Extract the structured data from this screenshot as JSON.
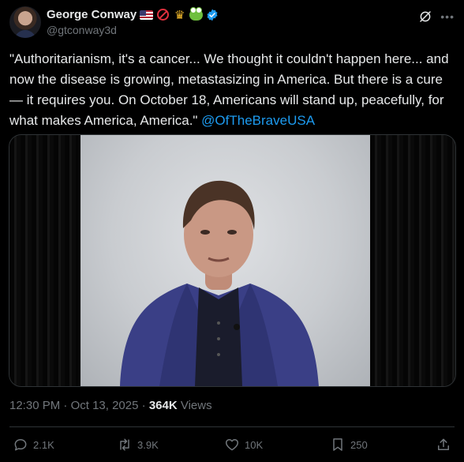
{
  "author": {
    "name": "George Conway",
    "handle": "@gtconway3d",
    "badges": [
      "us-flag-emoji",
      "no-entry-emoji",
      "crown-emoji",
      "frog-emoji",
      "verified-badge"
    ]
  },
  "tweet": {
    "text": "\"Authoritarianism, it's a cancer...  We thought it couldn't happen here... and now the disease is growing, metastasizing in America.  But there is a cure — it requires you.  On October 18, Americans will stand up, peacefully, for what makes America, America.\" ",
    "mention": "@OfTheBraveUSA"
  },
  "meta": {
    "time": "12:30 PM",
    "sep1": " · ",
    "date": "Oct 13, 2025",
    "sep2": " · ",
    "views_count": "364K",
    "views_label": " Views"
  },
  "actions": {
    "replies": "2.1K",
    "reposts": "3.9K",
    "likes": "10K",
    "bookmarks": "250"
  },
  "colors": {
    "background": "#000000",
    "text": "#e7e9ea",
    "muted": "#71767b",
    "accent": "#1d9bf0"
  }
}
